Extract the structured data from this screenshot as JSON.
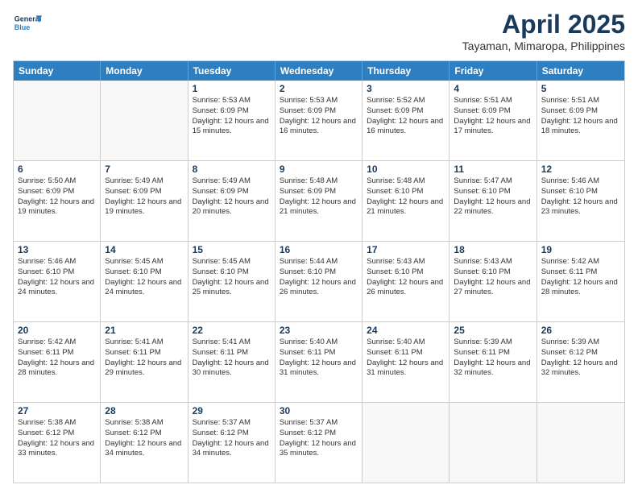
{
  "header": {
    "logo_general": "General",
    "logo_blue": "Blue",
    "main_title": "April 2025",
    "subtitle": "Tayaman, Mimaropa, Philippines"
  },
  "weekdays": [
    "Sunday",
    "Monday",
    "Tuesday",
    "Wednesday",
    "Thursday",
    "Friday",
    "Saturday"
  ],
  "rows": [
    [
      {
        "day": "",
        "info": "",
        "empty": true
      },
      {
        "day": "",
        "info": "",
        "empty": true
      },
      {
        "day": "1",
        "info": "Sunrise: 5:53 AM\nSunset: 6:09 PM\nDaylight: 12 hours and 15 minutes."
      },
      {
        "day": "2",
        "info": "Sunrise: 5:53 AM\nSunset: 6:09 PM\nDaylight: 12 hours and 16 minutes."
      },
      {
        "day": "3",
        "info": "Sunrise: 5:52 AM\nSunset: 6:09 PM\nDaylight: 12 hours and 16 minutes."
      },
      {
        "day": "4",
        "info": "Sunrise: 5:51 AM\nSunset: 6:09 PM\nDaylight: 12 hours and 17 minutes."
      },
      {
        "day": "5",
        "info": "Sunrise: 5:51 AM\nSunset: 6:09 PM\nDaylight: 12 hours and 18 minutes."
      }
    ],
    [
      {
        "day": "6",
        "info": "Sunrise: 5:50 AM\nSunset: 6:09 PM\nDaylight: 12 hours and 19 minutes."
      },
      {
        "day": "7",
        "info": "Sunrise: 5:49 AM\nSunset: 6:09 PM\nDaylight: 12 hours and 19 minutes."
      },
      {
        "day": "8",
        "info": "Sunrise: 5:49 AM\nSunset: 6:09 PM\nDaylight: 12 hours and 20 minutes."
      },
      {
        "day": "9",
        "info": "Sunrise: 5:48 AM\nSunset: 6:09 PM\nDaylight: 12 hours and 21 minutes."
      },
      {
        "day": "10",
        "info": "Sunrise: 5:48 AM\nSunset: 6:10 PM\nDaylight: 12 hours and 21 minutes."
      },
      {
        "day": "11",
        "info": "Sunrise: 5:47 AM\nSunset: 6:10 PM\nDaylight: 12 hours and 22 minutes."
      },
      {
        "day": "12",
        "info": "Sunrise: 5:46 AM\nSunset: 6:10 PM\nDaylight: 12 hours and 23 minutes."
      }
    ],
    [
      {
        "day": "13",
        "info": "Sunrise: 5:46 AM\nSunset: 6:10 PM\nDaylight: 12 hours and 24 minutes."
      },
      {
        "day": "14",
        "info": "Sunrise: 5:45 AM\nSunset: 6:10 PM\nDaylight: 12 hours and 24 minutes."
      },
      {
        "day": "15",
        "info": "Sunrise: 5:45 AM\nSunset: 6:10 PM\nDaylight: 12 hours and 25 minutes."
      },
      {
        "day": "16",
        "info": "Sunrise: 5:44 AM\nSunset: 6:10 PM\nDaylight: 12 hours and 26 minutes."
      },
      {
        "day": "17",
        "info": "Sunrise: 5:43 AM\nSunset: 6:10 PM\nDaylight: 12 hours and 26 minutes."
      },
      {
        "day": "18",
        "info": "Sunrise: 5:43 AM\nSunset: 6:10 PM\nDaylight: 12 hours and 27 minutes."
      },
      {
        "day": "19",
        "info": "Sunrise: 5:42 AM\nSunset: 6:11 PM\nDaylight: 12 hours and 28 minutes."
      }
    ],
    [
      {
        "day": "20",
        "info": "Sunrise: 5:42 AM\nSunset: 6:11 PM\nDaylight: 12 hours and 28 minutes."
      },
      {
        "day": "21",
        "info": "Sunrise: 5:41 AM\nSunset: 6:11 PM\nDaylight: 12 hours and 29 minutes."
      },
      {
        "day": "22",
        "info": "Sunrise: 5:41 AM\nSunset: 6:11 PM\nDaylight: 12 hours and 30 minutes."
      },
      {
        "day": "23",
        "info": "Sunrise: 5:40 AM\nSunset: 6:11 PM\nDaylight: 12 hours and 31 minutes."
      },
      {
        "day": "24",
        "info": "Sunrise: 5:40 AM\nSunset: 6:11 PM\nDaylight: 12 hours and 31 minutes."
      },
      {
        "day": "25",
        "info": "Sunrise: 5:39 AM\nSunset: 6:11 PM\nDaylight: 12 hours and 32 minutes."
      },
      {
        "day": "26",
        "info": "Sunrise: 5:39 AM\nSunset: 6:12 PM\nDaylight: 12 hours and 32 minutes."
      }
    ],
    [
      {
        "day": "27",
        "info": "Sunrise: 5:38 AM\nSunset: 6:12 PM\nDaylight: 12 hours and 33 minutes."
      },
      {
        "day": "28",
        "info": "Sunrise: 5:38 AM\nSunset: 6:12 PM\nDaylight: 12 hours and 34 minutes."
      },
      {
        "day": "29",
        "info": "Sunrise: 5:37 AM\nSunset: 6:12 PM\nDaylight: 12 hours and 34 minutes."
      },
      {
        "day": "30",
        "info": "Sunrise: 5:37 AM\nSunset: 6:12 PM\nDaylight: 12 hours and 35 minutes."
      },
      {
        "day": "",
        "info": "",
        "empty": true
      },
      {
        "day": "",
        "info": "",
        "empty": true
      },
      {
        "day": "",
        "info": "",
        "empty": true
      }
    ]
  ]
}
